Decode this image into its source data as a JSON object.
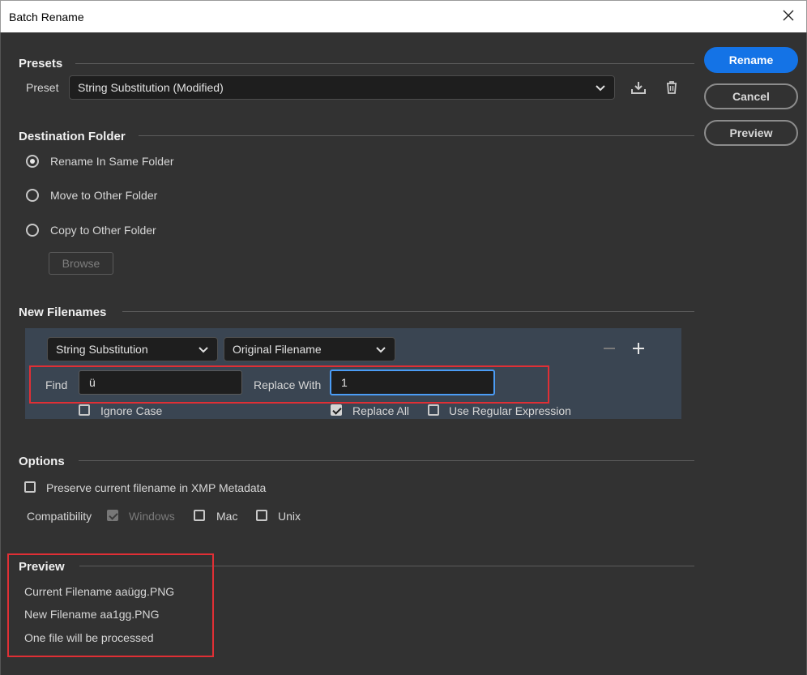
{
  "window": {
    "title": "Batch Rename"
  },
  "actions": {
    "rename": "Rename",
    "cancel": "Cancel",
    "preview": "Preview"
  },
  "presets": {
    "section_title": "Presets",
    "preset_label": "Preset",
    "preset_value": "String Substitution (Modified)"
  },
  "destination": {
    "section_title": "Destination Folder",
    "options": [
      {
        "label": "Rename In Same Folder",
        "checked": true
      },
      {
        "label": "Move to Other Folder",
        "checked": false
      },
      {
        "label": "Copy to Other Folder",
        "checked": false
      }
    ],
    "browse_label": "Browse"
  },
  "new_filenames": {
    "section_title": "New Filenames",
    "type_select": "String Substitution",
    "source_select": "Original Filename",
    "find_label": "Find",
    "find_value": "ü",
    "replace_label": "Replace With",
    "replace_value": "1",
    "ignore_case_label": "Ignore Case",
    "ignore_case_checked": false,
    "replace_all_label": "Replace All",
    "replace_all_checked": true,
    "regex_label": "Use Regular Expression",
    "regex_checked": false
  },
  "options": {
    "section_title": "Options",
    "preserve_label": "Preserve current filename in XMP Metadata",
    "preserve_checked": false,
    "compatibility_label": "Compatibility",
    "windows_label": "Windows",
    "mac_label": "Mac",
    "unix_label": "Unix"
  },
  "preview": {
    "section_title": "Preview",
    "current_filename": "Current Filename aaügg.PNG",
    "new_filename": "New Filename aa1gg.PNG",
    "summary": "One file will be processed"
  },
  "colors": {
    "dialog_bg": "#323232",
    "panel_bg": "#3a4552",
    "accent": "#1473e6",
    "highlight_box": "#e02f35"
  }
}
